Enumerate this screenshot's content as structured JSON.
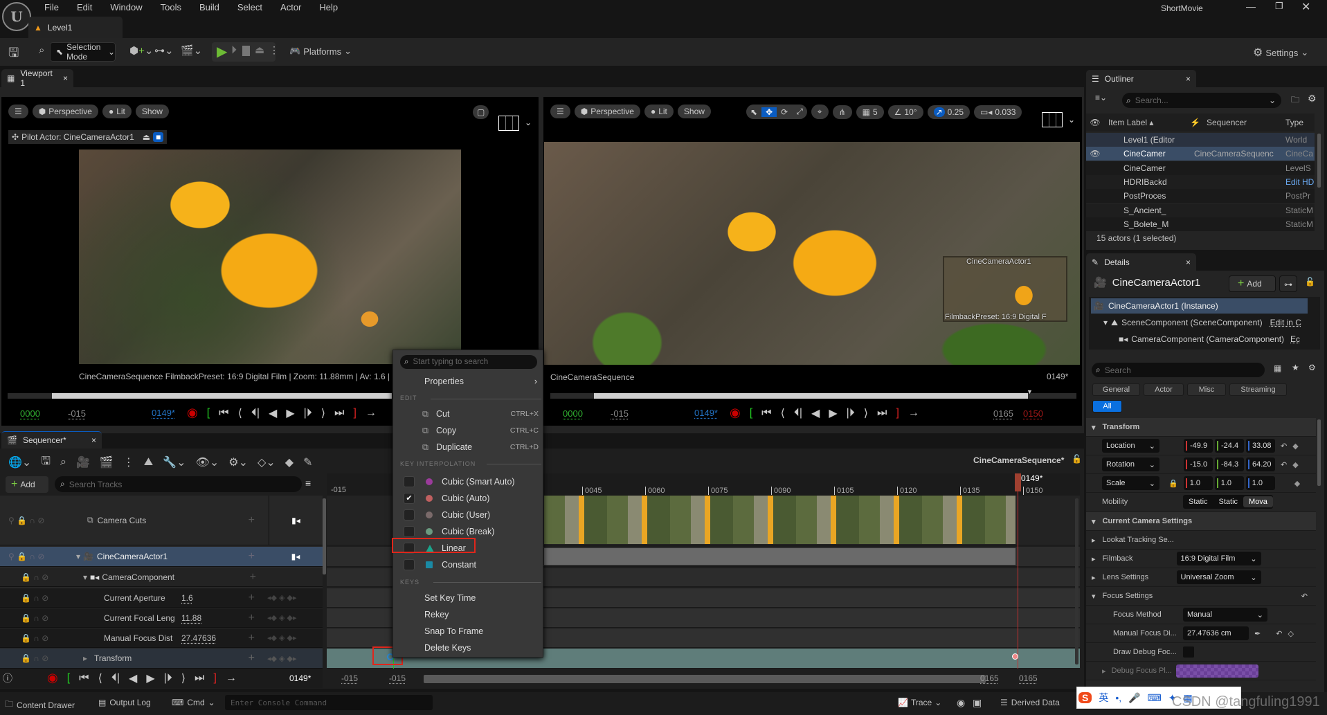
{
  "app": {
    "project": "ShortMovie",
    "level_tab": "Level1",
    "menu": [
      "File",
      "Edit",
      "Window",
      "Tools",
      "Build",
      "Select",
      "Actor",
      "Help"
    ]
  },
  "toolbar": {
    "selection_mode": "Selection Mode",
    "platforms": "Platforms",
    "settings": "Settings"
  },
  "viewport_tab": "Viewport 1",
  "left_viewport": {
    "perspective": "Perspective",
    "lit": "Lit",
    "show": "Show",
    "pilot": "Pilot Actor: CineCameraActor1",
    "info": "CineCameraSequence  FilmbackPreset: 16:9 Digital Film | Zoom: 11.88mm | Av: 1.6 | Squee",
    "start": "0000",
    "offset": "-015",
    "current": "0149*",
    "progress": 0.05
  },
  "right_viewport": {
    "perspective": "Perspective",
    "lit": "Lit",
    "show": "Show",
    "grid": "5",
    "angle": "10°",
    "scale_snap": "0.25",
    "camera_speed": "0.033",
    "overlay_actor": "CineCameraActor1",
    "overlay_filmback": "FilmbackPreset: 16:9 Digital F",
    "sequence": "CineCameraSequence",
    "frame": "0149*",
    "start": "0000",
    "offset": "-015",
    "current": "0149*",
    "end_view": "0165",
    "end": "0150"
  },
  "sequencer": {
    "tab": "Sequencer*",
    "add": "Add",
    "search_placeholder": "Search Tracks",
    "sequence_name": "CineCameraSequence*",
    "playhead": "0149*",
    "ruler_start": "-015",
    "ticks": [
      "0045",
      "0060",
      "0075",
      "0090",
      "0105",
      "0120",
      "0135",
      "0150"
    ],
    "tracks": [
      {
        "name": "Camera Cuts"
      },
      {
        "name": "CineCameraActor1"
      },
      {
        "name": "CameraComponent"
      },
      {
        "name": "Current Aperture",
        "value": "1.6"
      },
      {
        "name": "Current Focal Leng",
        "value": "11.88"
      },
      {
        "name": "Manual Focus Dist",
        "value": "27.47636"
      },
      {
        "name": "Transform"
      }
    ],
    "bottom": {
      "current": "0149*",
      "view_start": "-015",
      "play_start": "-015",
      "view_end": "0165",
      "play_end": "0165"
    }
  },
  "context_menu": {
    "search_placeholder": "Start typing to search",
    "properties": "Properties",
    "edit_header": "EDIT",
    "edit": [
      {
        "label": "Cut",
        "shortcut": "CTRL+X"
      },
      {
        "label": "Copy",
        "shortcut": "CTRL+C"
      },
      {
        "label": "Duplicate",
        "shortcut": "CTRL+D"
      }
    ],
    "interp_header": "KEY INTERPOLATION",
    "interp": [
      {
        "label": "Cubic (Smart Auto)",
        "color": "#9b3b9b",
        "checked": false
      },
      {
        "label": "Cubic (Auto)",
        "color": "#c06060",
        "checked": true
      },
      {
        "label": "Cubic (User)",
        "color": "#7a6a6a",
        "checked": false
      },
      {
        "label": "Cubic (Break)",
        "color": "#6a9a80",
        "checked": false
      },
      {
        "label": "Linear",
        "color": "#1aa58c",
        "checked": false
      },
      {
        "label": "Constant",
        "color": "#1a8aa5",
        "checked": false
      }
    ],
    "keys_header": "KEYS",
    "keys": [
      "Set Key Time",
      "Rekey",
      "Snap To Frame",
      "Delete Keys"
    ]
  },
  "outliner": {
    "tab": "Outliner",
    "search_placeholder": "Search...",
    "cols": [
      "Item Label",
      "Sequencer",
      "Type"
    ],
    "rows": [
      {
        "label": "Level1 (Editor",
        "seq": "",
        "type": "World"
      },
      {
        "label": "CineCamer",
        "seq": "CineCameraSequenc",
        "type": "CineCa"
      },
      {
        "label": "CineCamer",
        "seq": "",
        "type": "LevelS"
      },
      {
        "label": "HDRIBackd",
        "seq": "",
        "type": "Edit HD"
      },
      {
        "label": "PostProces",
        "seq": "",
        "type": "PostPr"
      },
      {
        "label": "S_Ancient_",
        "seq": "",
        "type": "StaticM"
      },
      {
        "label": "S_Bolete_M",
        "seq": "",
        "type": "StaticM"
      }
    ],
    "status": "15 actors (1 selected)"
  },
  "details": {
    "tab": "Details",
    "actor": "CineCameraActor1",
    "add": "Add",
    "components": [
      "CineCameraActor1 (Instance)",
      "SceneComponent (SceneComponent)",
      "CameraComponent (CameraComponent)"
    ],
    "edit_in": "Edit in C",
    "edit_short": "Ec",
    "search_placeholder": "Search",
    "filters": [
      "General",
      "Actor",
      "Misc",
      "Streaming",
      "All"
    ],
    "transform": "Transform",
    "location": {
      "label": "Location",
      "x": "-49.9",
      "y": "-24.4",
      "z": "33.08"
    },
    "rotation": {
      "label": "Rotation",
      "x": "-15.0",
      "y": "-84.3",
      "z": "64.20"
    },
    "scale": {
      "label": "Scale",
      "x": "1.0",
      "y": "1.0",
      "z": "1.0"
    },
    "mobility": {
      "label": "Mobility",
      "options": [
        "Static",
        "Static",
        "Mova"
      ]
    },
    "camera_settings": "Current Camera Settings",
    "lookat": "Lookat Tracking Se...",
    "filmback": {
      "label": "Filmback",
      "value": "16:9 Digital Film"
    },
    "lens": {
      "label": "Lens Settings",
      "value": "Universal Zoom"
    },
    "focus": "Focus Settings",
    "focus_method": {
      "label": "Focus Method",
      "value": "Manual"
    },
    "manual_focus": {
      "label": "Manual Focus Di...",
      "value": "27.47636 cm"
    },
    "draw_debug": "Draw Debug Foc...",
    "debug_plane": "Debug Focus Pl..."
  },
  "statusbar": {
    "content_drawer": "Content Drawer",
    "output_log": "Output Log",
    "cmd": "Cmd",
    "console_placeholder": "Enter Console Command",
    "trace": "Trace",
    "derived": "Derived Data",
    "ime_lang": "英",
    "watermark": "CSDN @tangfuling1991"
  },
  "colors": {
    "accent": "#0a5cc2",
    "highlight": "#e0261b",
    "selection": "#3a4d66"
  }
}
